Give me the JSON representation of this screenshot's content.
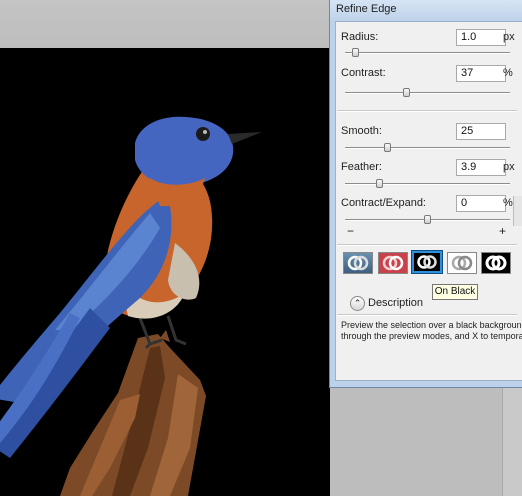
{
  "dialog": {
    "title": "Refine Edge",
    "radius": {
      "label": "Radius:",
      "value": "1.0",
      "unit": "px",
      "level": 0.05
    },
    "contrast": {
      "label": "Contrast:",
      "value": "37",
      "unit": "%",
      "level": 0.37
    },
    "smooth": {
      "label": "Smooth:",
      "value": "25",
      "level": 0.25
    },
    "feather": {
      "label": "Feather:",
      "value": "3.9",
      "unit": "px",
      "level": 0.16
    },
    "contract_expand": {
      "label": "Contract/Expand:",
      "value": "0",
      "unit": "%",
      "level": 0.5,
      "minus": "−",
      "plus": "+"
    },
    "preview_modes": [
      {
        "name": "standard",
        "selected": false
      },
      {
        "name": "quick-mask",
        "selected": false
      },
      {
        "name": "on-black",
        "selected": true
      },
      {
        "name": "on-white",
        "selected": false
      },
      {
        "name": "mask",
        "selected": false
      }
    ],
    "tooltip": "On Black",
    "description": {
      "toggle": "⌃",
      "label": "Description",
      "line1": "Preview the selection over a black background. Pr",
      "line2": "through the preview modes, and X to temporarily v"
    }
  },
  "colors": {
    "dialog_border": "#6f86a6",
    "selection_highlight": "#2f8fd8",
    "canvas_background": "#000000"
  }
}
